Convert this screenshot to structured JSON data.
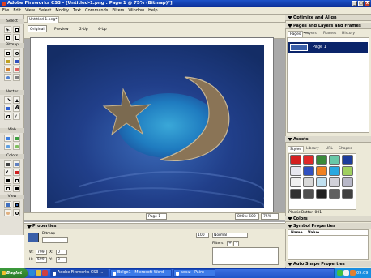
{
  "window": {
    "title": "Adobe Fireworks CS3 - [Untitled-1.png : Page 1 @ 75% (Bitmap)*]"
  },
  "menu": [
    "File",
    "Edit",
    "View",
    "Select",
    "Modify",
    "Text",
    "Commands",
    "Filters",
    "Window",
    "Help"
  ],
  "toolbox": {
    "sections": [
      "Select",
      "Bitmap",
      "Vector",
      "Web",
      "Colors",
      "View"
    ]
  },
  "document": {
    "tab": "Untitled-1.png*",
    "views": [
      "Original",
      "Preview",
      "2-Up",
      "4-Up"
    ],
    "active_view": "Original",
    "status_page": "Page 1",
    "status_size": "800 x 600",
    "status_zoom": "75%"
  },
  "panels": {
    "optimize": "Optimize and Align",
    "pages_header": "Pages and Layers and Frames and ...",
    "pages_tabs": [
      "Pages",
      "Layers",
      "Frames",
      "History"
    ],
    "active_pages_tab": "Pages",
    "page_item": "Page 1",
    "assets": "Assets",
    "asset_tabs": [
      "Styles",
      "Library",
      "URL",
      "Shapes"
    ],
    "active_asset_tab": "Styles",
    "style_name": "Plastic Button 001",
    "colors": "Colors",
    "symbol_properties": "Symbol Properties",
    "symbol_cols": [
      "Name",
      "Value"
    ],
    "auto_shape": "Auto Shape Properties"
  },
  "properties": {
    "title": "Properties",
    "object_type": "Bitmap",
    "w": "799",
    "h": "599",
    "x": "0",
    "y": "3",
    "opacity": "100",
    "blend": "Normal",
    "filters_label": "Filters:"
  },
  "taskbar": {
    "start": "Başlat",
    "tasks": [
      "Adobe Fireworks CS3 ...",
      "Belge1 - Microsoft Word",
      "adsız - Paint"
    ],
    "clock": "09:09"
  },
  "colors": {
    "accent": "#0a246a",
    "title_blue": "#1c52c8",
    "task_green": "#2a7a2a"
  }
}
